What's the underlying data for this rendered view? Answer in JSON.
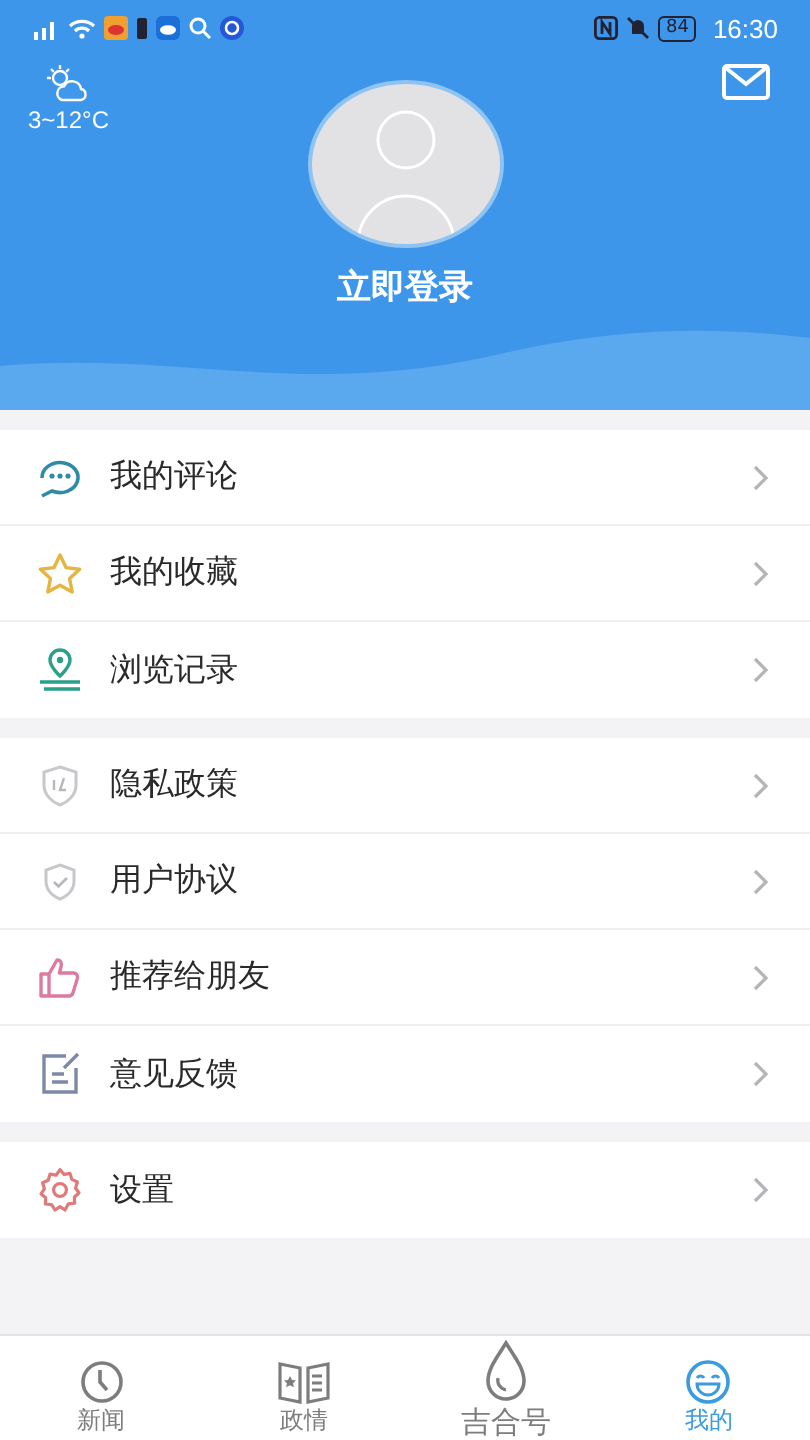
{
  "status_bar": {
    "battery": "84",
    "time": "16:30"
  },
  "header": {
    "weather": "3~12°C",
    "login": "立即登录"
  },
  "groups": [
    {
      "items": [
        {
          "kind": "comment",
          "label": "我的评论"
        },
        {
          "kind": "star",
          "label": "我的收藏"
        },
        {
          "kind": "history",
          "label": "浏览记录"
        }
      ]
    },
    {
      "items": [
        {
          "kind": "privacy",
          "label": "隐私政策"
        },
        {
          "kind": "agreement",
          "label": "用户协议"
        },
        {
          "kind": "recommend",
          "label": "推荐给朋友"
        },
        {
          "kind": "feedback",
          "label": "意见反馈"
        }
      ]
    },
    {
      "items": [
        {
          "kind": "settings",
          "label": "设置"
        }
      ]
    }
  ],
  "tabs": [
    {
      "kind": "news",
      "label": "新闻",
      "selected": false
    },
    {
      "kind": "politics",
      "label": "政情",
      "selected": false
    },
    {
      "kind": "drop",
      "label": "吉合号",
      "selected": false
    },
    {
      "kind": "mine",
      "label": "我的",
      "selected": true
    }
  ]
}
